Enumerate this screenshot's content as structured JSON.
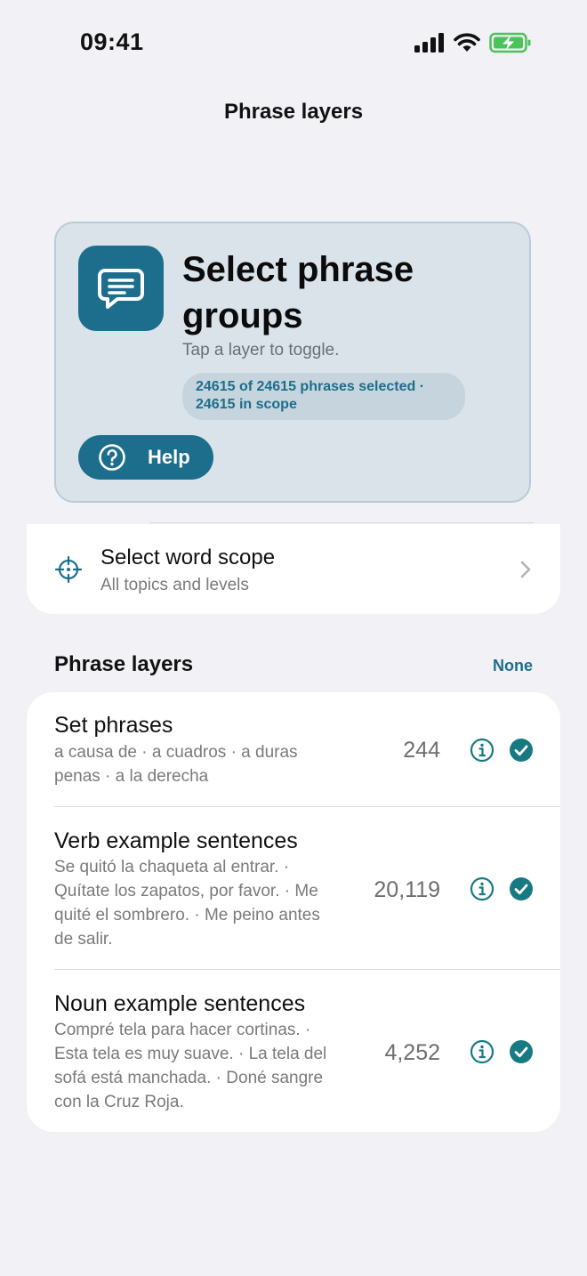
{
  "status_bar": {
    "time": "09:41"
  },
  "nav": {
    "title": "Phrase layers"
  },
  "hero": {
    "title": "Select phrase groups",
    "subtitle": "Tap a layer to toggle.",
    "selection_summary": "24615 of 24615 phrases selected · 24615 in scope",
    "help_label": "Help"
  },
  "scope": {
    "title": "Select word scope",
    "subtitle": "All topics and levels"
  },
  "layers_section": {
    "title": "Phrase layers",
    "none_label": "None",
    "items": [
      {
        "title": "Set phrases",
        "description": "a causa de · a cuadros · a duras penas · a la derecha",
        "count": "244",
        "selected": true
      },
      {
        "title": "Verb example sentences",
        "description": "Se quitó la chaqueta al entrar. · Quítate los zapatos, por favor. · Me quité el sombrero. · Me peino antes de salir.",
        "count": "20,119",
        "selected": true
      },
      {
        "title": "Noun example sentences",
        "description": "Compré tela para hacer cortinas. · Esta tela es muy suave. · La tela del sofá está manchada. · Doné sangre con la Cruz Roja.",
        "count": "4,252",
        "selected": true
      }
    ]
  },
  "colors": {
    "accent": "#1d6e8c",
    "check": "#177a82",
    "battery": "#4cc25a"
  },
  "icons": {
    "status": [
      "cellular-signal-icon",
      "wifi-icon",
      "battery-charging-icon"
    ],
    "hero": "chat-bubble-icon",
    "help": "question-circle-icon",
    "scope": "crosshair-icon",
    "scope_chevron": "chevron-right-icon",
    "layer_info": "info-circle-icon",
    "layer_check": "checkmark-circle-icon"
  }
}
